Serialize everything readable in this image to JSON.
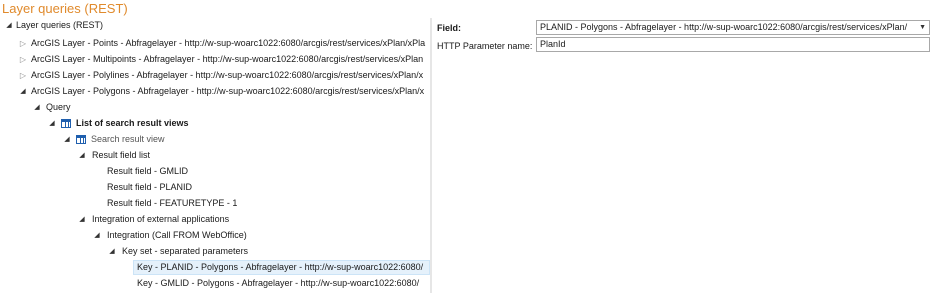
{
  "header": {
    "title": "Layer queries (REST)"
  },
  "tree": {
    "root": {
      "label": "Layer queries (REST)"
    },
    "layer_points": {
      "label": "ArcGIS Layer - Points - Abfragelayer - http://w-sup-woarc1022:6080/arcgis/rest/services/xPlan/xPla"
    },
    "layer_multipoints": {
      "label": "ArcGIS Layer - Multipoints - Abfragelayer - http://w-sup-woarc1022:6080/arcgis/rest/services/xPlan"
    },
    "layer_polylines": {
      "label": "ArcGIS Layer - Polylines - Abfragelayer - http://w-sup-woarc1022:6080/arcgis/rest/services/xPlan/x"
    },
    "layer_polygons": {
      "label": "ArcGIS Layer - Polygons - Abfragelayer - http://w-sup-woarc1022:6080/arcgis/rest/services/xPlan/x"
    },
    "query": {
      "label": "Query"
    },
    "list_views": {
      "label": "List of search result views"
    },
    "search_view": {
      "label": "Search result view"
    },
    "field_list": {
      "label": "Result field list"
    },
    "field_gmlid": {
      "label": "Result field - GMLID"
    },
    "field_planid": {
      "label": "Result field - PLANID"
    },
    "field_featuretype": {
      "label": "Result field - FEATURETYPE - 1"
    },
    "integration_ext": {
      "label": "Integration of external applications"
    },
    "integration_call": {
      "label": "Integration (Call FROM WebOffice)"
    },
    "keyset": {
      "label": "Key set - separated parameters"
    },
    "key_planid": {
      "label": "Key - PLANID - Polygons - Abfragelayer - http://w-sup-woarc1022:6080/"
    },
    "key_gmlid": {
      "label": "Key - GMLID - Polygons - Abfragelayer - http://w-sup-woarc1022:6080/"
    }
  },
  "properties": {
    "field": {
      "label": "Field:",
      "value": "PLANID - Polygons - Abfragelayer - http://w-sup-woarc1022:6080/arcgis/rest/services/xPlan/"
    },
    "http_param": {
      "label": "HTTP Parameter name:",
      "value": "PlanId"
    }
  }
}
